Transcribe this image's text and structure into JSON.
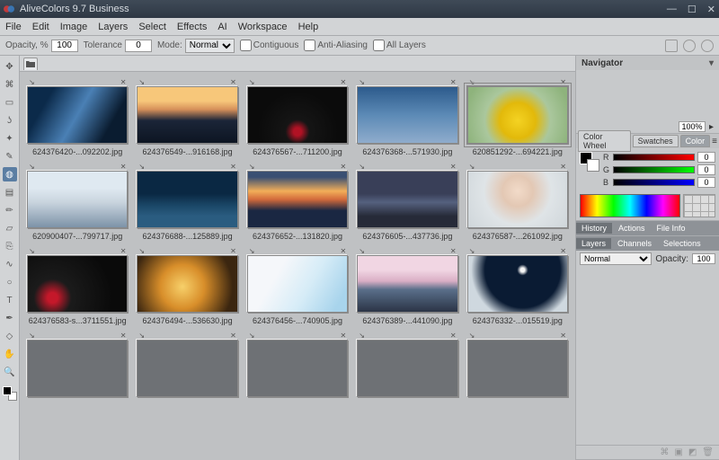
{
  "title": "AliveColors 9.7 Business",
  "menu": [
    "File",
    "Edit",
    "Image",
    "Layers",
    "Select",
    "Effects",
    "AI",
    "Workspace",
    "Help"
  ],
  "optbar": {
    "opacity_label": "Opacity, %",
    "opacity": "100",
    "tolerance_label": "Tolerance",
    "tolerance": "0",
    "mode_label": "Mode:",
    "mode": "Normal",
    "contiguous": "Contiguous",
    "antialias": "Anti-Aliasing",
    "alllayers": "All Layers"
  },
  "tools": [
    "move",
    "crop",
    "select-rect",
    "lasso",
    "wand",
    "eyedrop",
    "bucket",
    "gradient",
    "brush",
    "eraser",
    "clone",
    "smudge",
    "blur",
    "text",
    "pen",
    "shape",
    "hand",
    "zoom"
  ],
  "thumbs": [
    {
      "file": "624376420-...092202.jpg",
      "cls": "g-fashion"
    },
    {
      "file": "624376549-...916168.jpg",
      "cls": "g-mountlake"
    },
    {
      "file": "624376567-...711200.jpg",
      "cls": "g-hat"
    },
    {
      "file": "624376368-...571930.jpg",
      "cls": "g-eagle"
    },
    {
      "file": "620851292-...694221.jpg",
      "cls": "g-flowers",
      "sel": true
    },
    {
      "file": "620900407-...799717.jpg",
      "cls": "g-columns"
    },
    {
      "file": "624376688-...125889.jpg",
      "cls": "g-citynight"
    },
    {
      "file": "624376652-...131820.jpg",
      "cls": "g-sunsetdock"
    },
    {
      "file": "624376605-...437736.jpg",
      "cls": "g-storm"
    },
    {
      "file": "624376587-...261092.jpg",
      "cls": "g-portrait"
    },
    {
      "file": "624376583-s...3711551.jpg",
      "cls": "g-hat2"
    },
    {
      "file": "624376494-...536630.jpg",
      "cls": "g-glitter"
    },
    {
      "file": "624376456-...740905.jpg",
      "cls": "g-pose"
    },
    {
      "file": "624376389-...441090.jpg",
      "cls": "g-peak"
    },
    {
      "file": "624376332-...015519.jpg",
      "cls": "g-moon"
    },
    {
      "file": "",
      "cls": "g-void"
    },
    {
      "file": "",
      "cls": "g-void"
    },
    {
      "file": "",
      "cls": "g-void"
    },
    {
      "file": "",
      "cls": "g-void"
    },
    {
      "file": "",
      "cls": "g-void"
    }
  ],
  "panels": {
    "navigator": "Navigator",
    "zoom": "100%",
    "color_tabs": [
      "Color Wheel",
      "Swatches",
      "Color"
    ],
    "rgb": {
      "r": "0",
      "g": "0",
      "b": "0"
    },
    "hist_tabs": [
      "History",
      "Actions",
      "File Info"
    ],
    "layer_tabs": [
      "Layers",
      "Channels",
      "Selections"
    ],
    "blend": "Normal",
    "opacity_label": "Opacity:",
    "layer_opacity": "100"
  }
}
